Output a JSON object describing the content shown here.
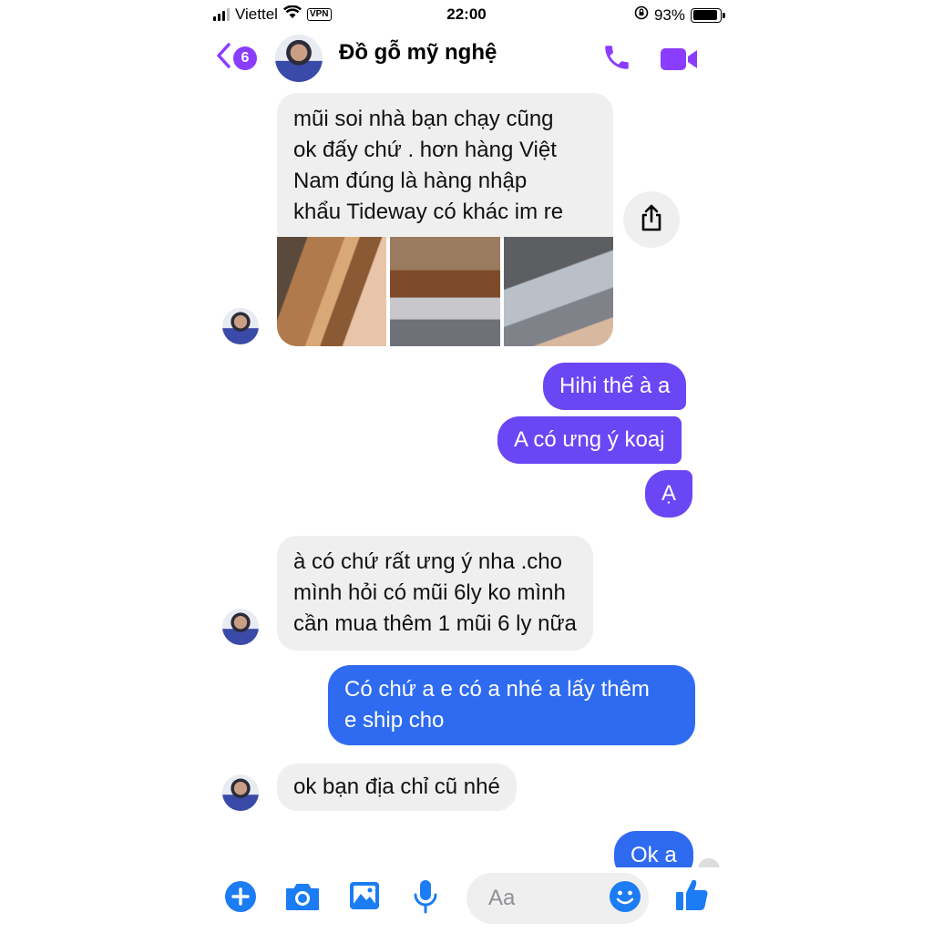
{
  "status_bar": {
    "carrier": "Viettel",
    "vpn": "VPN",
    "time": "22:00",
    "battery": "93%",
    "battery_level": 0.93
  },
  "header": {
    "back_count": "6",
    "title": "Đồ gỗ mỹ nghệ",
    "icons": [
      "back-chevron-icon",
      "phone-icon",
      "video-camera-icon"
    ]
  },
  "messages": [
    {
      "from": "them",
      "text": "mũi soi nhà bạn chạy cũng\nok đấy chứ . hơn hàng Việt\nNam đúng là hàng nhập\nkhẩu Tideway có khác im re",
      "attachments": 3
    },
    {
      "from": "me",
      "text": "Hihi thế à a"
    },
    {
      "from": "me",
      "text": "A có ưng ý koaj"
    },
    {
      "from": "me",
      "text": "Ạ"
    },
    {
      "from": "them",
      "text": "à có chứ rất ưng ý nha .cho\nmình hỏi có mũi 6ly ko mình\ncần mua thêm 1 mũi 6 ly nữa"
    },
    {
      "from": "me",
      "text": "Có chứ a e có a nhé a lấy thêm\ne ship cho"
    },
    {
      "from": "them",
      "text": "ok bạn địa chỉ cũ nhé"
    },
    {
      "from": "me",
      "text": "Ok a"
    }
  ],
  "composer": {
    "placeholder": "Aa",
    "icons": [
      "plus-icon",
      "camera-icon",
      "photo-icon",
      "mic-icon",
      "emoji-icon",
      "like-icon"
    ]
  },
  "colors": {
    "accent_purple": "#8b3dff",
    "bubble_purple": "#6a46f5",
    "bubble_blue": "#2f6bf0",
    "bubble_gray": "#efefef",
    "composer_blue": "#1c7cf4"
  }
}
